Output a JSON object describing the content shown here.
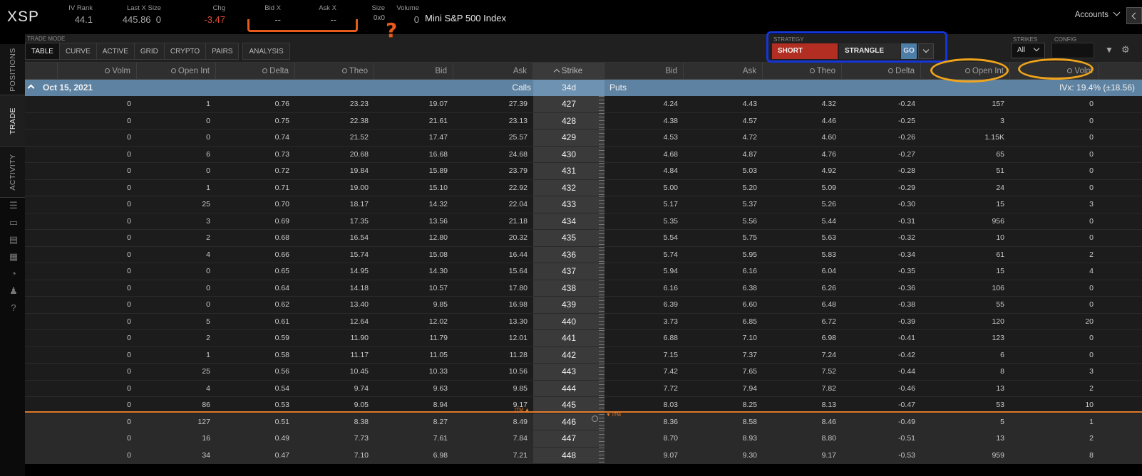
{
  "quote": {
    "symbol": "XSP",
    "iv_rank_label": "IV Rank",
    "iv_rank": "44.1",
    "last_label": "Last X Size",
    "last": "445.86",
    "last_size": "0",
    "chg_label": "Chg",
    "chg": "-3.47",
    "bidx_label": "Bid X",
    "bidx": "--",
    "askx_label": "Ask X",
    "askx": "--",
    "size_label": "Size",
    "size": "0x0",
    "volume_label": "Volume",
    "volume": "0",
    "description": "Mini S&P 500 Index",
    "accounts": "Accounts"
  },
  "rail": {
    "positions": "POSITIONS",
    "trade": "TRADE",
    "activity": "ACTIVITY"
  },
  "mode": {
    "label": "TRADE MODE",
    "tabs": [
      "TABLE",
      "CURVE",
      "ACTIVE",
      "GRID",
      "CRYPTO",
      "PAIRS"
    ],
    "analysis": "ANALYSIS"
  },
  "strategy": {
    "label": "STRATEGY",
    "side": "SHORT",
    "type": "STRANGLE",
    "go": "GO"
  },
  "strikes": {
    "label": "STRIKES",
    "value": "All"
  },
  "config": {
    "label": "CONFIG"
  },
  "columns": {
    "calls": [
      "Volm",
      "Open Int",
      "Delta",
      "Theo",
      "Bid",
      "Ask"
    ],
    "strike": "Strike",
    "puts": [
      "Bid",
      "Ask",
      "Theo",
      "Delta",
      "Open Int",
      "Volm"
    ]
  },
  "expiration": {
    "date": "Oct 15, 2021",
    "calls": "Calls",
    "dte": "34d",
    "puts": "Puts",
    "ivx": "IVx: 19.4% (±18.56)"
  },
  "itm_label": "ITM",
  "colors": {
    "short": "#b22e22",
    "go": "#4d7ea8",
    "chg": "#d94a3a",
    "expiration_bar": "#5e83a2",
    "atm_line": "#e07a2b"
  },
  "rows": [
    {
      "c": [
        "0",
        "1",
        "0.76",
        "23.23",
        "19.07",
        "27.39"
      ],
      "k": "427",
      "p": [
        "4.24",
        "4.43",
        "4.32",
        "-0.24",
        "157",
        "0"
      ]
    },
    {
      "c": [
        "0",
        "0",
        "0.75",
        "22.38",
        "21.61",
        "23.13"
      ],
      "k": "428",
      "p": [
        "4.38",
        "4.57",
        "4.46",
        "-0.25",
        "3",
        "0"
      ]
    },
    {
      "c": [
        "0",
        "0",
        "0.74",
        "21.52",
        "17.47",
        "25.57"
      ],
      "k": "429",
      "p": [
        "4.53",
        "4.72",
        "4.60",
        "-0.26",
        "1.15K",
        "0"
      ]
    },
    {
      "c": [
        "0",
        "6",
        "0.73",
        "20.68",
        "16.68",
        "24.68"
      ],
      "k": "430",
      "p": [
        "4.68",
        "4.87",
        "4.76",
        "-0.27",
        "65",
        "0"
      ]
    },
    {
      "c": [
        "0",
        "0",
        "0.72",
        "19.84",
        "15.89",
        "23.79"
      ],
      "k": "431",
      "p": [
        "4.84",
        "5.03",
        "4.92",
        "-0.28",
        "51",
        "0"
      ]
    },
    {
      "c": [
        "0",
        "1",
        "0.71",
        "19.00",
        "15.10",
        "22.92"
      ],
      "k": "432",
      "p": [
        "5.00",
        "5.20",
        "5.09",
        "-0.29",
        "24",
        "0"
      ]
    },
    {
      "c": [
        "0",
        "25",
        "0.70",
        "18.17",
        "14.32",
        "22.04"
      ],
      "k": "433",
      "p": [
        "5.17",
        "5.37",
        "5.26",
        "-0.30",
        "15",
        "3"
      ]
    },
    {
      "c": [
        "0",
        "3",
        "0.69",
        "17.35",
        "13.56",
        "21.18"
      ],
      "k": "434",
      "p": [
        "5.35",
        "5.56",
        "5.44",
        "-0.31",
        "956",
        "0"
      ]
    },
    {
      "c": [
        "0",
        "2",
        "0.68",
        "16.54",
        "12.80",
        "20.32"
      ],
      "k": "435",
      "p": [
        "5.54",
        "5.75",
        "5.63",
        "-0.32",
        "10",
        "0"
      ]
    },
    {
      "c": [
        "0",
        "4",
        "0.66",
        "15.74",
        "15.08",
        "16.44"
      ],
      "k": "436",
      "p": [
        "5.74",
        "5.95",
        "5.83",
        "-0.34",
        "61",
        "2"
      ]
    },
    {
      "c": [
        "0",
        "0",
        "0.65",
        "14.95",
        "14.30",
        "15.64"
      ],
      "k": "437",
      "p": [
        "5.94",
        "6.16",
        "6.04",
        "-0.35",
        "15",
        "4"
      ]
    },
    {
      "c": [
        "0",
        "0",
        "0.64",
        "14.18",
        "10.57",
        "17.80"
      ],
      "k": "438",
      "p": [
        "6.16",
        "6.38",
        "6.26",
        "-0.36",
        "106",
        "0"
      ]
    },
    {
      "c": [
        "0",
        "0",
        "0.62",
        "13.40",
        "9.85",
        "16.98"
      ],
      "k": "439",
      "p": [
        "6.39",
        "6.60",
        "6.48",
        "-0.38",
        "55",
        "0"
      ]
    },
    {
      "c": [
        "0",
        "5",
        "0.61",
        "12.64",
        "12.02",
        "13.30"
      ],
      "k": "440",
      "p": [
        "3.73",
        "6.85",
        "6.72",
        "-0.39",
        "120",
        "20"
      ]
    },
    {
      "c": [
        "0",
        "2",
        "0.59",
        "11.90",
        "11.79",
        "12.01"
      ],
      "k": "441",
      "p": [
        "6.88",
        "7.10",
        "6.98",
        "-0.41",
        "123",
        "0"
      ]
    },
    {
      "c": [
        "0",
        "1",
        "0.58",
        "11.17",
        "11.05",
        "11.28"
      ],
      "k": "442",
      "p": [
        "7.15",
        "7.37",
        "7.24",
        "-0.42",
        "6",
        "0"
      ]
    },
    {
      "c": [
        "0",
        "25",
        "0.56",
        "10.45",
        "10.33",
        "10.56"
      ],
      "k": "443",
      "p": [
        "7.42",
        "7.65",
        "7.52",
        "-0.44",
        "8",
        "3"
      ]
    },
    {
      "c": [
        "0",
        "4",
        "0.54",
        "9.74",
        "9.63",
        "9.85"
      ],
      "k": "444",
      "p": [
        "7.72",
        "7.94",
        "7.82",
        "-0.46",
        "13",
        "2"
      ]
    },
    {
      "c": [
        "0",
        "86",
        "0.53",
        "9.05",
        "8.94",
        "9.17"
      ],
      "k": "445",
      "p": [
        "8.03",
        "8.25",
        "8.13",
        "-0.47",
        "53",
        "10"
      ]
    },
    {
      "c": [
        "0",
        "127",
        "0.51",
        "8.38",
        "8.27",
        "8.49"
      ],
      "k": "446",
      "p": [
        "8.36",
        "8.58",
        "8.46",
        "-0.49",
        "5",
        "1"
      ]
    },
    {
      "c": [
        "0",
        "16",
        "0.49",
        "7.73",
        "7.61",
        "7.84"
      ],
      "k": "447",
      "p": [
        "8.70",
        "8.93",
        "8.80",
        "-0.51",
        "13",
        "2"
      ]
    },
    {
      "c": [
        "0",
        "34",
        "0.47",
        "7.10",
        "6.98",
        "7.21"
      ],
      "k": "448",
      "p": [
        "9.07",
        "9.30",
        "9.17",
        "-0.53",
        "959",
        "8"
      ]
    }
  ],
  "annotation": {
    "question": "?"
  }
}
